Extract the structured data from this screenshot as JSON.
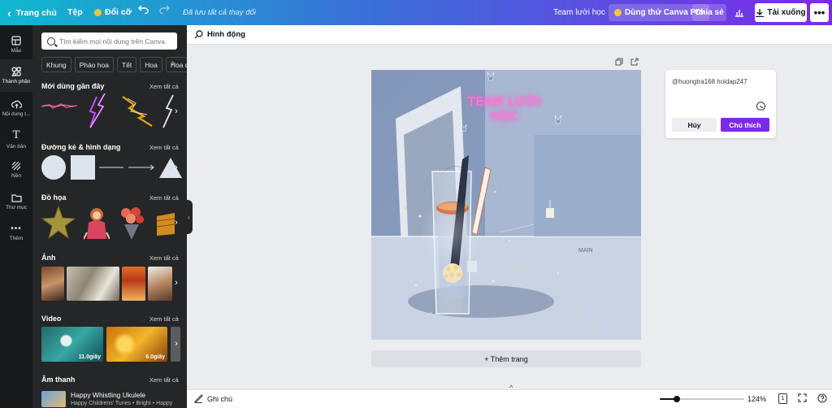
{
  "topbar": {
    "back_label": "Trang chủ",
    "file_label": "Tệp",
    "resize_label": "Đổi cỡ",
    "saved_status": "Đã lưu tất cả thay đổi",
    "design_title": "Team lười học",
    "pro_label": "Dùng thử Canva Pro",
    "share_label": "Chia sẻ",
    "download_label": "Tải xuống"
  },
  "rail": {
    "items": [
      {
        "label": "Mẫu",
        "icon": "layout-icon"
      },
      {
        "label": "Thành phần",
        "icon": "elements-icon"
      },
      {
        "label": "Nội dung t...",
        "icon": "upload-icon"
      },
      {
        "label": "Văn bản",
        "icon": "text-icon"
      },
      {
        "label": "Nền",
        "icon": "background-icon"
      },
      {
        "label": "Thư mục",
        "icon": "folder-icon"
      },
      {
        "label": "Thêm",
        "icon": "more-icon"
      }
    ]
  },
  "panel": {
    "search_placeholder": "Tìm kiếm mọi nội dung trên Canva",
    "chips": [
      "Khung",
      "Pháo hoa",
      "Tết",
      "Hoa",
      "Hoa đà"
    ],
    "see_all": "Xem tất cả",
    "sections": {
      "recent": "Mới dùng gần đây",
      "lines": "Đường kẻ & hình dạng",
      "graphics": "Đồ họa",
      "photos": "Ảnh",
      "videos": "Video",
      "audio": "Âm thanh"
    },
    "videos": [
      {
        "duration": "11.0giây"
      },
      {
        "duration": "6.0giây"
      }
    ],
    "audio_item": {
      "title": "Happy Whistling Ukulele",
      "subtitle": "Happy Childrens' Tunes • Bright • Happy"
    }
  },
  "context_bar": {
    "animate_label": "Hình động"
  },
  "artboard": {
    "headline": "TEAM LƯỜI HỌC",
    "watermark": "MAIN"
  },
  "comment": {
    "text": "@huongtra168 hoidap247",
    "cancel_label": "Hủy",
    "submit_label": "Chú thích"
  },
  "add_page_label": "+ Thêm trang",
  "bottombar": {
    "notes_label": "Ghi chú",
    "zoom_label": "124%",
    "zoom_level": 0.2,
    "page_number": "1"
  },
  "colors": {
    "accent": "#7d2ae8",
    "gradient_start": "#0fb8ce",
    "panel_bg": "#252627",
    "rail_bg": "#18191b"
  }
}
